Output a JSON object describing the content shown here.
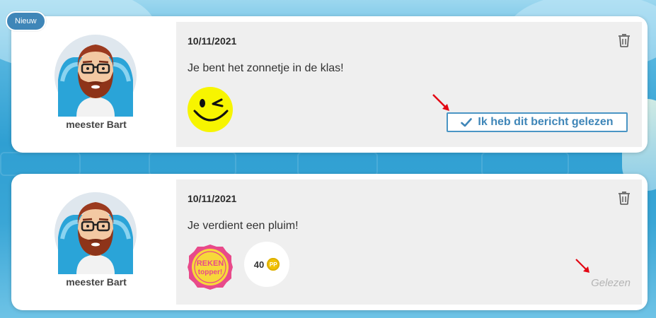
{
  "messages": [
    {
      "is_new": true,
      "badge_label": "Nieuw",
      "sender": {
        "name": "meester Bart",
        "avatar": "teacher-avatar"
      },
      "date": "10/11/2021",
      "text": "Je bent het zonnetje in de klas!",
      "sticker": "winking-smiley",
      "read_button_label": "Ik heb dit bericht gelezen"
    },
    {
      "is_new": false,
      "sender": {
        "name": "meester Bart",
        "avatar": "teacher-avatar"
      },
      "date": "10/11/2021",
      "text": "Je verdient een pluim!",
      "sticker": "reken-topper-badge",
      "sticker_text_line1": "REKEN",
      "sticker_text_line2": "topper!",
      "points": {
        "value": "40",
        "unit": "PP"
      },
      "read_status": "Gelezen"
    }
  ],
  "colors": {
    "accent": "#3f86b8",
    "annotation_arrow": "#e30613",
    "smiley": "#f7f500",
    "sticker_pink": "#e84a8a"
  }
}
